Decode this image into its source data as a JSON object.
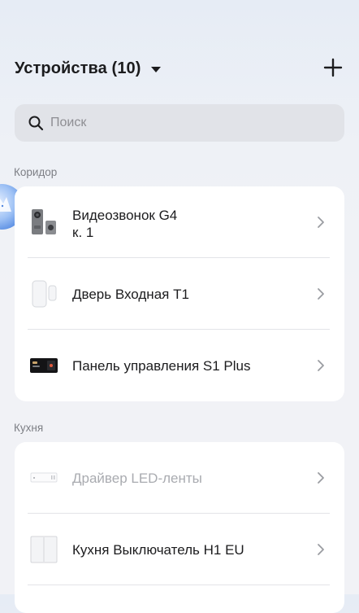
{
  "header": {
    "title": "Устройства (10)",
    "add_icon": "plus-icon",
    "caret_icon": "caret-down-icon"
  },
  "search": {
    "placeholder": "Поиск",
    "value": "",
    "icon": "search-icon"
  },
  "sections": [
    {
      "label": "Коридор",
      "devices": [
        {
          "name_line1": "Видеозвонок G4",
          "name_line2": "к. 1",
          "enabled": true,
          "icon": "video-doorbell-icon"
        },
        {
          "name": "Дверь Входная T1",
          "enabled": true,
          "icon": "door-sensor-icon"
        },
        {
          "name": "Панель управления S1 Plus",
          "enabled": true,
          "icon": "control-panel-icon"
        }
      ]
    },
    {
      "label": "Кухня",
      "devices": [
        {
          "name": "Драйвер LED-ленты",
          "enabled": false,
          "icon": "led-driver-icon"
        },
        {
          "name": "Кухня Выключатель H1 EU",
          "enabled": true,
          "icon": "wall-switch-icon"
        }
      ]
    }
  ],
  "colors": {
    "text": "#1c1c1e",
    "muted_text": "#a9abb0",
    "section_label": "#7d7f85",
    "card_bg": "#ffffff",
    "search_bg": "#e1e3e8",
    "accent_blob": "#5b8fe6"
  }
}
